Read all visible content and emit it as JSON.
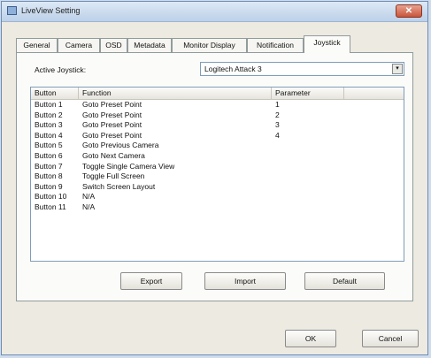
{
  "window": {
    "title": "LiveView Setting",
    "close_symbol": "✕"
  },
  "tabs": [
    {
      "label": "General"
    },
    {
      "label": "Camera"
    },
    {
      "label": "OSD"
    },
    {
      "label": "Metadata"
    },
    {
      "label": "Monitor Display"
    },
    {
      "label": "Notification"
    },
    {
      "label": "Joystick",
      "active": true
    }
  ],
  "joystick": {
    "label": "Active Joystick:",
    "selected": "Logitech Attack 3",
    "arrow": "▾"
  },
  "table": {
    "columns": [
      "Button",
      "Function",
      "Parameter",
      ""
    ],
    "rows": [
      [
        "Button 1",
        "Goto Preset Point",
        "1"
      ],
      [
        "Button 2",
        "Goto Preset Point",
        "2"
      ],
      [
        "Button 3",
        "Goto Preset Point",
        "3"
      ],
      [
        "Button 4",
        "Goto Preset Point",
        "4"
      ],
      [
        "Button 5",
        "Goto Previous Camera",
        ""
      ],
      [
        "Button 6",
        "Goto Next Camera",
        ""
      ],
      [
        "Button 7",
        "Toggle Single Camera View",
        ""
      ],
      [
        "Button 8",
        "Toggle Full Screen",
        ""
      ],
      [
        "Button 9",
        "Switch Screen Layout",
        ""
      ],
      [
        "Button 10",
        "N/A",
        ""
      ],
      [
        "Button 11",
        "N/A",
        ""
      ]
    ]
  },
  "actions": {
    "export": "Export",
    "import": "Import",
    "default": "Default"
  },
  "dialog": {
    "ok": "OK",
    "cancel": "Cancel"
  },
  "colors": {
    "titlebar": "#bcd0e8",
    "close": "#c8553a",
    "window": "#edeae2"
  }
}
